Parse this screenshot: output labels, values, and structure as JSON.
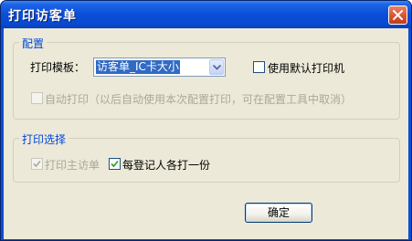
{
  "window": {
    "title": "打印访客单"
  },
  "config_group": {
    "legend": "配置",
    "template_label": "打印模板：",
    "template_selected": "访客单_IC卡大小",
    "default_printer_label": "使用默认打印机",
    "default_printer_checked": false,
    "auto_print_label": "自动打印（以后自动使用本次配置打印，可在配置工具中取消）",
    "auto_print_checked": false,
    "auto_print_enabled": false
  },
  "print_group": {
    "legend": "打印选择",
    "print_main_label": "打印主访单",
    "print_main_checked": true,
    "print_main_enabled": false,
    "each_person_label": "每登记人各打一份",
    "each_person_checked": true
  },
  "buttons": {
    "ok_label": "确定"
  },
  "colors": {
    "title_bar": "#0a4ed8",
    "dialog_bg": "#ece9d8",
    "legend_text": "#0046d5",
    "selection": "#316ac5",
    "close_button": "#d9532f"
  }
}
